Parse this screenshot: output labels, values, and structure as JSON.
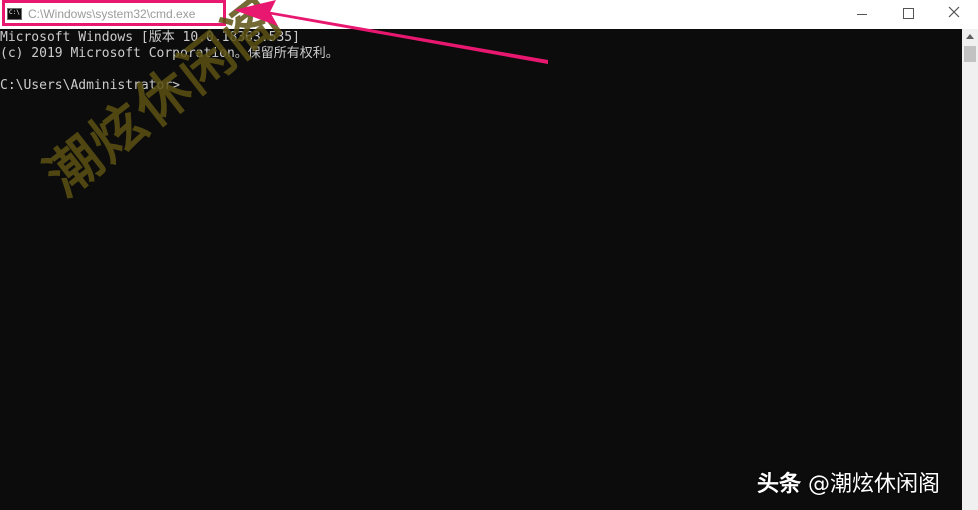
{
  "window": {
    "title": "C:\\Windows\\system32\\cmd.exe",
    "icon_text": "C:\\",
    "controls": [
      "minimize",
      "maximize",
      "close"
    ]
  },
  "console": {
    "lines": [
      "Microsoft Windows [版本 10.0.18363.535]",
      "(c) 2019 Microsoft Corporation。保留所有权利。",
      "",
      "C:\\Users\\Administrator>"
    ]
  },
  "watermarks": {
    "diagonal": "潮炫休闲阁",
    "corner_brand": "头条",
    "corner_handle": "@潮炫休闲阁"
  },
  "colors": {
    "highlight": "#e8176f",
    "console_bg": "#0c0c0c",
    "console_text": "#cccccc",
    "watermark": "#5b5113"
  },
  "icons": {
    "app": "cmd-app-icon",
    "minimize": "minimize-icon",
    "maximize": "maximize-icon",
    "close": "close-icon",
    "scroll_up": "scroll-up-arrow-icon"
  }
}
